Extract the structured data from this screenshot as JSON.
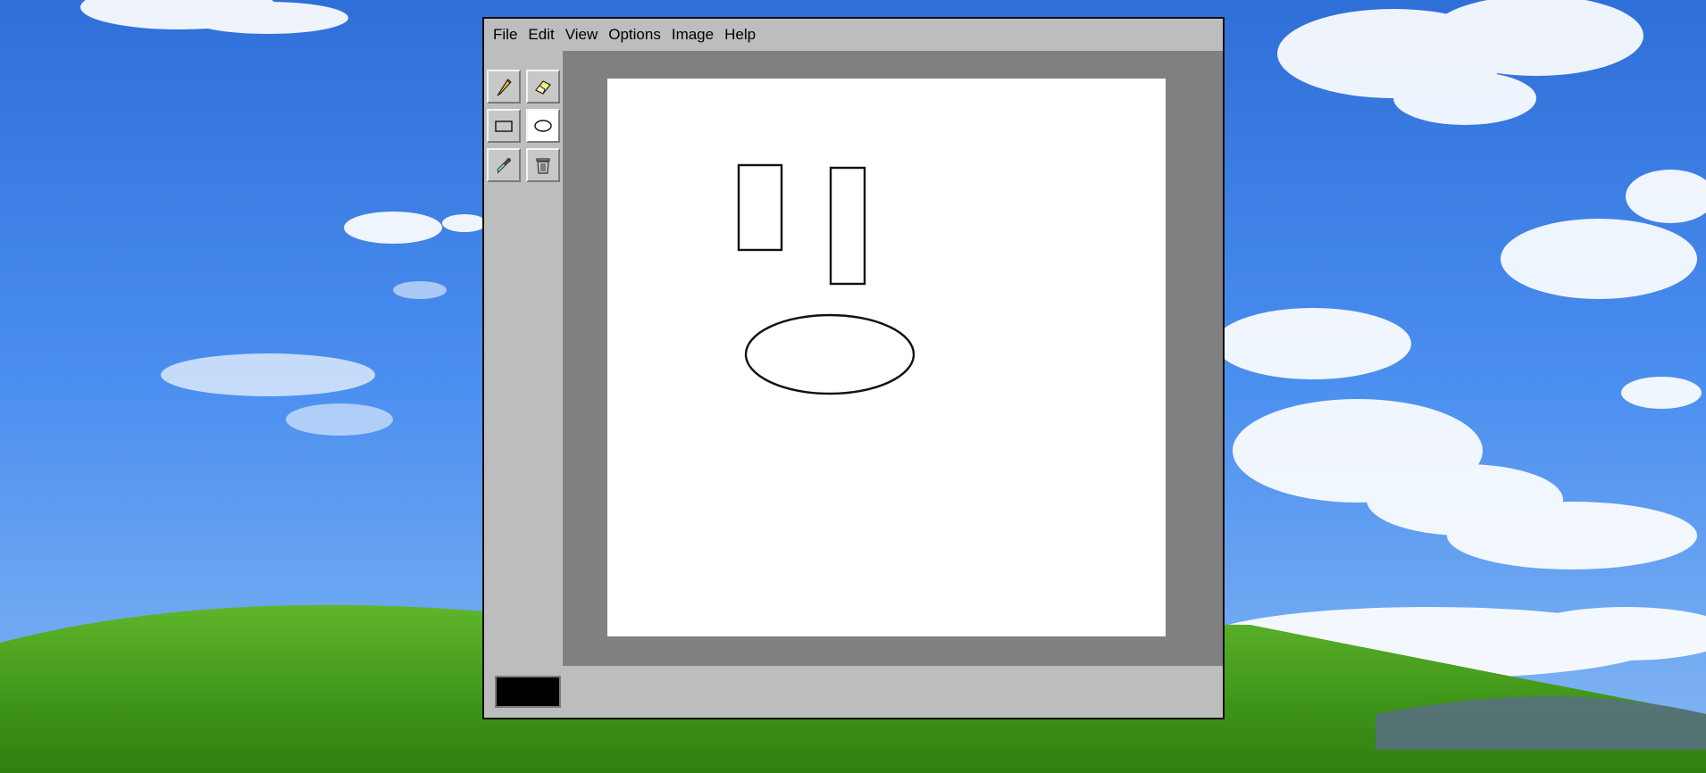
{
  "menu": {
    "file": "File",
    "edit": "Edit",
    "view": "View",
    "options": "Options",
    "image": "Image",
    "help": "Help"
  },
  "tools": {
    "selected": "ellipse",
    "items": [
      "pencil",
      "eraser",
      "rectangle",
      "ellipse",
      "color-picker",
      "clear"
    ]
  },
  "current_color": "#000000",
  "colors": {
    "window": "#bdbdbd",
    "canvas_bg": "#808080",
    "canvas": "#ffffff"
  }
}
